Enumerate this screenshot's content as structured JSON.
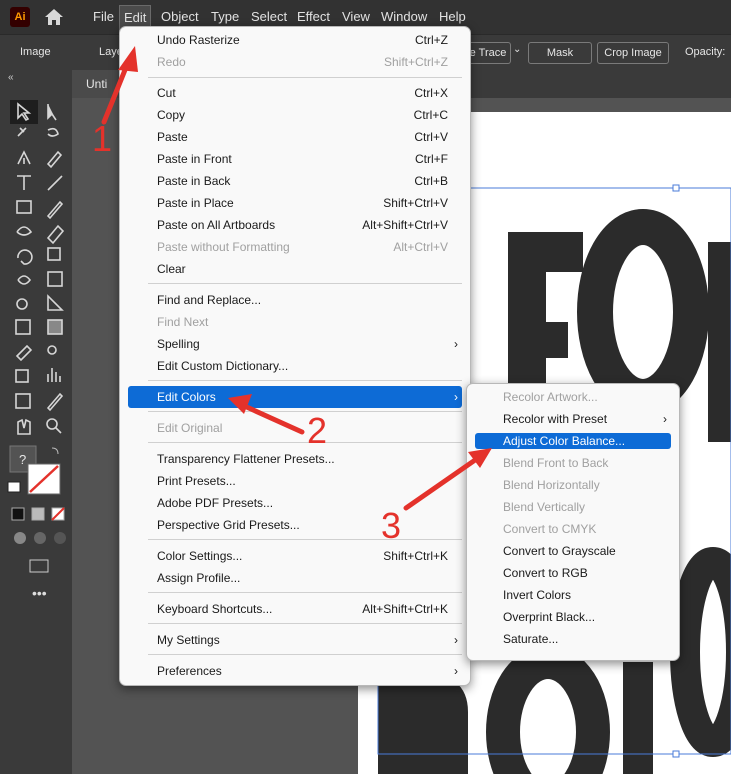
{
  "app": {
    "logo": "Ai",
    "home_icon": "home-icon"
  },
  "menubar": {
    "items": [
      "File",
      "Edit",
      "Object",
      "Type",
      "Select",
      "Effect",
      "View",
      "Window",
      "Help"
    ],
    "active": "Edit"
  },
  "controlbar": {
    "image_label": "Image",
    "layer_label": "Laye",
    "trace_button": "e Trace",
    "mask_button": "Mask",
    "crop_button": "Crop Image",
    "opacity_label": "Opacity:"
  },
  "document_tab": {
    "title": "Unti"
  },
  "edit_menu": {
    "items": [
      {
        "label": "Undo Rasterize",
        "shortcut": "Ctrl+Z",
        "disabled": false
      },
      {
        "label": "Redo",
        "shortcut": "Shift+Ctrl+Z",
        "disabled": true
      },
      {
        "label": "Cut",
        "shortcut": "Ctrl+X",
        "disabled": false
      },
      {
        "label": "Copy",
        "shortcut": "Ctrl+C",
        "disabled": false
      },
      {
        "label": "Paste",
        "shortcut": "Ctrl+V",
        "disabled": false
      },
      {
        "label": "Paste in Front",
        "shortcut": "Ctrl+F",
        "disabled": false
      },
      {
        "label": "Paste in Back",
        "shortcut": "Ctrl+B",
        "disabled": false
      },
      {
        "label": "Paste in Place",
        "shortcut": "Shift+Ctrl+V",
        "disabled": false
      },
      {
        "label": "Paste on All Artboards",
        "shortcut": "Alt+Shift+Ctrl+V",
        "disabled": false
      },
      {
        "label": "Paste without Formatting",
        "shortcut": "Alt+Ctrl+V",
        "disabled": true
      },
      {
        "label": "Clear",
        "shortcut": "",
        "disabled": false
      },
      {
        "label": "Find and Replace...",
        "shortcut": "",
        "disabled": false
      },
      {
        "label": "Find Next",
        "shortcut": "",
        "disabled": true
      },
      {
        "label": "Spelling",
        "shortcut": "",
        "disabled": false,
        "submenu": true
      },
      {
        "label": "Edit Custom Dictionary...",
        "shortcut": "",
        "disabled": false
      },
      {
        "label": "Edit Colors",
        "shortcut": "",
        "disabled": false,
        "submenu": true,
        "highlighted": true
      },
      {
        "label": "Edit Original",
        "shortcut": "",
        "disabled": true
      },
      {
        "label": "Transparency Flattener Presets...",
        "shortcut": "",
        "disabled": false
      },
      {
        "label": "Print Presets...",
        "shortcut": "",
        "disabled": false
      },
      {
        "label": "Adobe PDF Presets...",
        "shortcut": "",
        "disabled": false
      },
      {
        "label": "Perspective Grid Presets...",
        "shortcut": "",
        "disabled": false
      },
      {
        "label": "Color Settings...",
        "shortcut": "Shift+Ctrl+K",
        "disabled": false
      },
      {
        "label": "Assign Profile...",
        "shortcut": "",
        "disabled": false
      },
      {
        "label": "Keyboard Shortcuts...",
        "shortcut": "Alt+Shift+Ctrl+K",
        "disabled": false
      },
      {
        "label": "My Settings",
        "shortcut": "",
        "disabled": false,
        "submenu": true
      },
      {
        "label": "Preferences",
        "shortcut": "",
        "disabled": false,
        "submenu": true
      }
    ]
  },
  "colors_submenu": {
    "items": [
      {
        "label": "Recolor Artwork...",
        "disabled": true
      },
      {
        "label": "Recolor with Preset",
        "disabled": false,
        "submenu": true
      },
      {
        "label": "Adjust Color Balance...",
        "disabled": false,
        "highlighted": true
      },
      {
        "label": "Blend Front to Back",
        "disabled": true
      },
      {
        "label": "Blend Horizontally",
        "disabled": true
      },
      {
        "label": "Blend Vertically",
        "disabled": true
      },
      {
        "label": "Convert to CMYK",
        "disabled": true
      },
      {
        "label": "Convert to Grayscale",
        "disabled": false
      },
      {
        "label": "Convert to RGB",
        "disabled": false
      },
      {
        "label": "Invert Colors",
        "disabled": false
      },
      {
        "label": "Overprint Black...",
        "disabled": false
      },
      {
        "label": "Saturate...",
        "disabled": false
      }
    ]
  },
  "annotations": {
    "step1": "1",
    "step2": "2",
    "step3": "3",
    "arrow_color": "#e4322b"
  },
  "colors": {
    "highlight": "#0d6bd6",
    "menu_bg": "#f9f9f9",
    "ui_dark": "#323232"
  }
}
